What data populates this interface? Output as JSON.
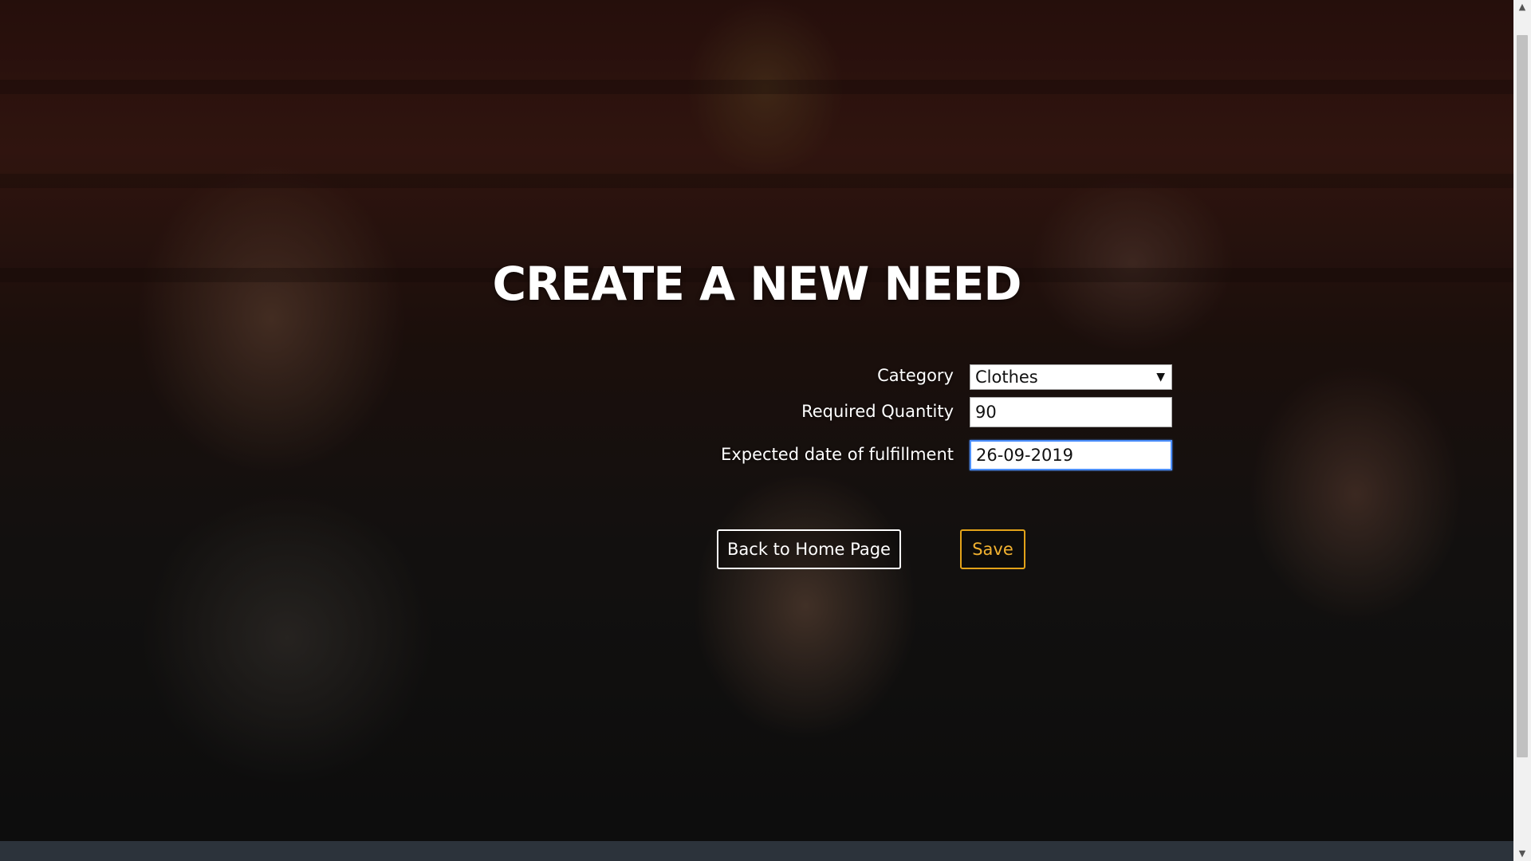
{
  "page": {
    "title": "CREATE A NEW NEED"
  },
  "form": {
    "category": {
      "label": "Category",
      "value": "Clothes",
      "arrow": "▼"
    },
    "quantity": {
      "label": "Required Quantity",
      "value": "90"
    },
    "date": {
      "label": "Expected date of fulfillment",
      "value": "26-09-2019"
    }
  },
  "buttons": {
    "home_label": "Back to Home Page",
    "save_label": "Save"
  },
  "scrollbar": {
    "up": "▲",
    "down": "▼"
  },
  "colors": {
    "accent_save": "#e3a319",
    "focus": "#4d90fe",
    "footer": "#2c333b"
  }
}
